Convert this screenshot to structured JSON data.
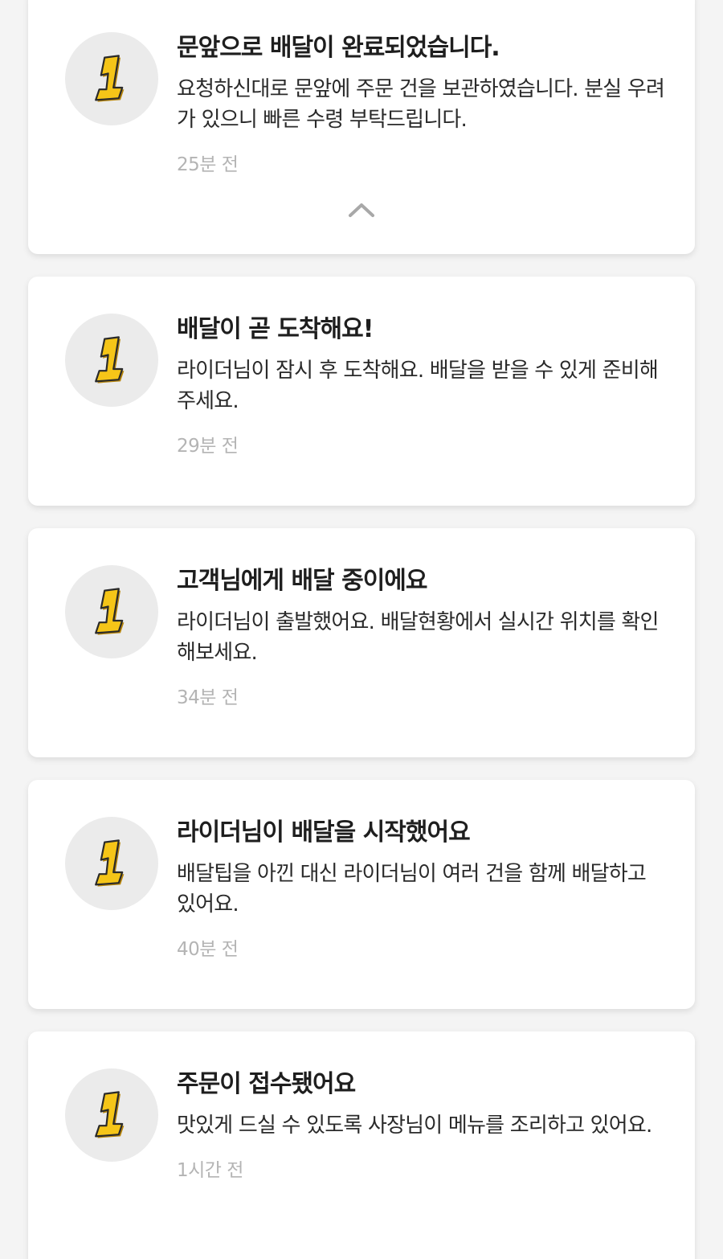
{
  "notifications": [
    {
      "title": "문앞으로 배달이 완료되었습니다.",
      "body": "요청하신대로 문앞에 주문 건을 보관하였습니다. 분실 우려가 있으니 빠른 수령 부탁드립니다.",
      "time": "25분 전",
      "icon": "number-one-gold-icon",
      "expanded": true
    },
    {
      "title": "배달이 곧 도착해요!",
      "body": "라이더님이 잠시 후 도착해요. 배달을 받을 수 있게 준비해 주세요.",
      "time": "29분 전",
      "icon": "number-one-gold-icon"
    },
    {
      "title": "고객님에게 배달 중이에요",
      "body": "라이더님이  출발했어요. 배달현황에서 실시간 위치를 확인해보세요.",
      "time": "34분 전",
      "icon": "number-one-gold-icon"
    },
    {
      "title": "라이더님이 배달을 시작했어요",
      "body": "배달팁을 아낀 대신 라이더님이 여러 건을 함께 배달하고 있어요.",
      "time": "40분 전",
      "icon": "number-one-gold-icon"
    },
    {
      "title": "주문이 접수됐어요",
      "body": "맛있게 드실 수 있도록 사장님이 메뉴를 조리하고 있어요.",
      "time": "1시간 전",
      "icon": "number-one-gold-icon"
    }
  ],
  "collapse_icon": "chevron-up-icon",
  "colors": {
    "background": "#f4f4f4",
    "card": "#ffffff",
    "title": "#1e1e1e",
    "time": "#b4b4b4",
    "icon_gold": "#f5c518"
  }
}
